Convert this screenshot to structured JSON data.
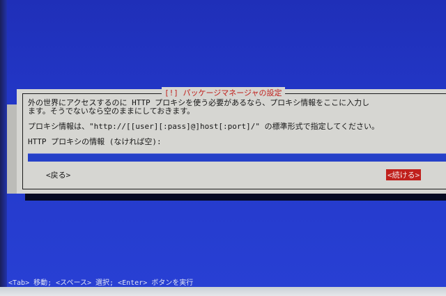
{
  "dialog": {
    "title": "[!] パッケージマネージャの設定",
    "description_line1": "外の世界にアクセスするのに HTTP プロキシを使う必要があるなら、プロキシ情報をここに入力し",
    "description_line2": "ます。そうでないなら空のままにしておきます。",
    "format_hint": "プロキシ情報は、\"http://[[user][:pass]@]host[:port]/\" の標準形式で指定してください。",
    "input_label": "HTTP プロキシの情報 (なければ空):",
    "input_value": "",
    "back_label": "<戻る>",
    "continue_label": "<続ける>"
  },
  "help": {
    "text": "<Tab> 移動; <スペース> 選択; <Enter> ボタンを実行"
  },
  "colors": {
    "background": "#2234c2",
    "dialog": "#d6d6d2",
    "title": "#c0201c",
    "input": "#2540c8",
    "button_focus": "#c0201c"
  }
}
